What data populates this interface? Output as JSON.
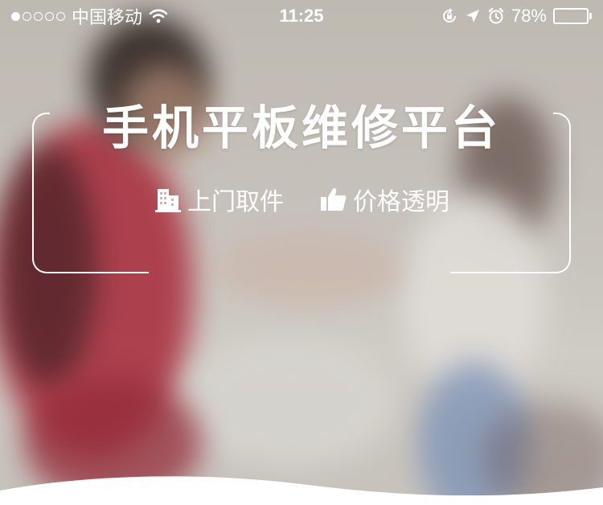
{
  "status_bar": {
    "carrier": "中国移动",
    "signal_filled": 1,
    "signal_total": 5,
    "time": "11:25",
    "battery_percent": "78%",
    "battery_level": 0.78
  },
  "hero": {
    "title": "手机平板维修平台",
    "features": [
      {
        "icon": "building-icon",
        "label": "上门取件"
      },
      {
        "icon": "thumbs-up-icon",
        "label": "价格透明"
      }
    ]
  },
  "colors": {
    "text": "#ffffff",
    "bottom": "#ffffff"
  }
}
